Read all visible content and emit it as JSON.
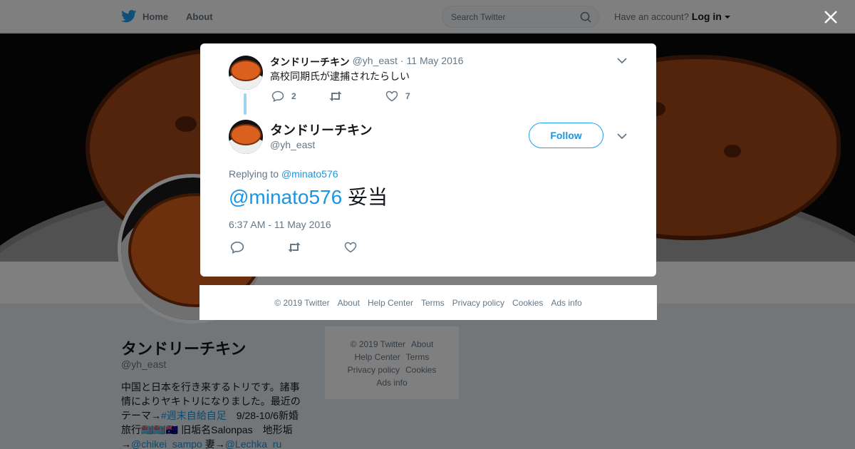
{
  "topbar": {
    "home_label": "Home",
    "about_label": "About",
    "search_placeholder": "Search Twitter",
    "have_account": "Have an account?",
    "login_label": "Log in"
  },
  "profile": {
    "name": "タンドリーチキン",
    "handle": "@yh_east",
    "bio_1": "中国と日本を行き来するトリです。諸事情によりヤキトリになりました。最近のテーマ→",
    "bio_link_1": "#週末自給自足",
    "bio_2": "　9/28-10/6新婚旅行🇫🇯🇫🇯🇦🇺 旧垢名Salonpas　地形垢→",
    "bio_link_2": "@chikei_sampo",
    "bio_3": " 妻→",
    "bio_link_3": "@Lechka_ru"
  },
  "side_footer": {
    "items": [
      "© 2019 Twitter",
      "About",
      "Help Center",
      "Terms",
      "Privacy policy",
      "Cookies",
      "Ads info"
    ]
  },
  "modal": {
    "parent_tweet": {
      "name": "タンドリーチキン",
      "handle": "@yh_east",
      "separator": "·",
      "date": "11 May 2016",
      "text": "高校同期氏が逮捕されたらしい",
      "reply_count": "2",
      "like_count": "7"
    },
    "main_tweet": {
      "name": "タンドリーチキン",
      "handle": "@yh_east",
      "follow_label": "Follow",
      "replying_to_label": "Replying to",
      "replying_to_handle": "@minato576",
      "mention": "@minato576",
      "text": " 妥当",
      "timestamp": "6:37 AM - 11 May 2016"
    }
  },
  "modal_footer": {
    "items": [
      "© 2019 Twitter",
      "About",
      "Help Center",
      "Terms",
      "Privacy policy",
      "Cookies",
      "Ads info"
    ]
  },
  "colors": {
    "twitter_blue": "#1da1f2",
    "link_blue": "#1b95e0",
    "secondary_text": "#657786"
  },
  "icons": [
    "twitter-bird-icon",
    "search-icon",
    "close-icon",
    "chevron-down-icon",
    "reply-icon",
    "retweet-icon",
    "like-icon"
  ]
}
